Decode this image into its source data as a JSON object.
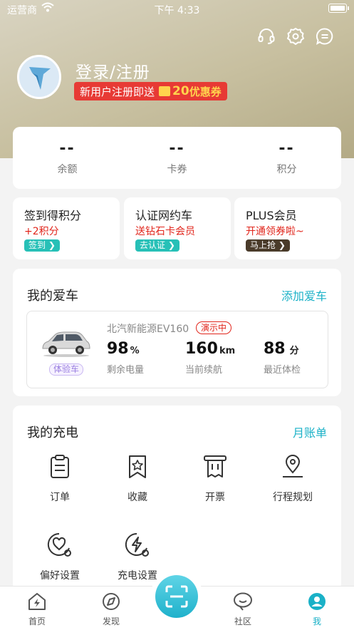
{
  "status_bar": {
    "carrier": "运营商",
    "time": "下午 4:33"
  },
  "header": {
    "login_text": "登录/注册",
    "promo_text": "新用户注册即送",
    "promo_amount": "20",
    "promo_suffix": "优惠券"
  },
  "stats": [
    {
      "value": "--",
      "label": "余额"
    },
    {
      "value": "--",
      "label": "卡券"
    },
    {
      "value": "--",
      "label": "积分"
    }
  ],
  "mini_cards": [
    {
      "title": "签到得积分",
      "subtitle": "+2积分",
      "button": "签到",
      "button_color": "#27c0b7"
    },
    {
      "title": "认证网约车",
      "subtitle": "送钻石卡会员",
      "button": "去认证",
      "button_color": "#27c0b7"
    },
    {
      "title": "PLUS会员",
      "subtitle": "开通领券啦~",
      "button": "马上抢",
      "button_color": "#4a3b2a"
    }
  ],
  "my_car": {
    "title": "我的爱车",
    "add_link": "添加爱车",
    "badge": "体验车",
    "model": "北汽新能源EV160",
    "status": "演示中",
    "metrics": [
      {
        "value": "98",
        "unit": "%",
        "label": "剩余电量"
      },
      {
        "value": "160",
        "unit": "km",
        "label": "当前续航"
      },
      {
        "value": "88",
        "unit": "分",
        "label": "最近体检"
      }
    ]
  },
  "my_charging": {
    "title": "我的充电",
    "link": "月账单",
    "items": [
      {
        "label": "订单",
        "icon": "clipboard-icon"
      },
      {
        "label": "收藏",
        "icon": "bookmark-star-icon"
      },
      {
        "label": "开票",
        "icon": "receipt-icon"
      },
      {
        "label": "行程规划",
        "icon": "location-pin-icon"
      },
      {
        "label": "偏好设置",
        "icon": "heart-settings-icon"
      },
      {
        "label": "充电设置",
        "icon": "bolt-settings-icon"
      }
    ]
  },
  "tabbar": [
    {
      "label": "首页",
      "icon": "home-bolt-icon"
    },
    {
      "label": "发现",
      "icon": "compass-icon"
    },
    {
      "label": "社区",
      "icon": "chat-bubble-icon"
    },
    {
      "label": "我",
      "icon": "profile-icon"
    }
  ],
  "colors": {
    "accent": "#1ab1c7",
    "red": "#e1251b",
    "hero": "#c7bf9f"
  }
}
